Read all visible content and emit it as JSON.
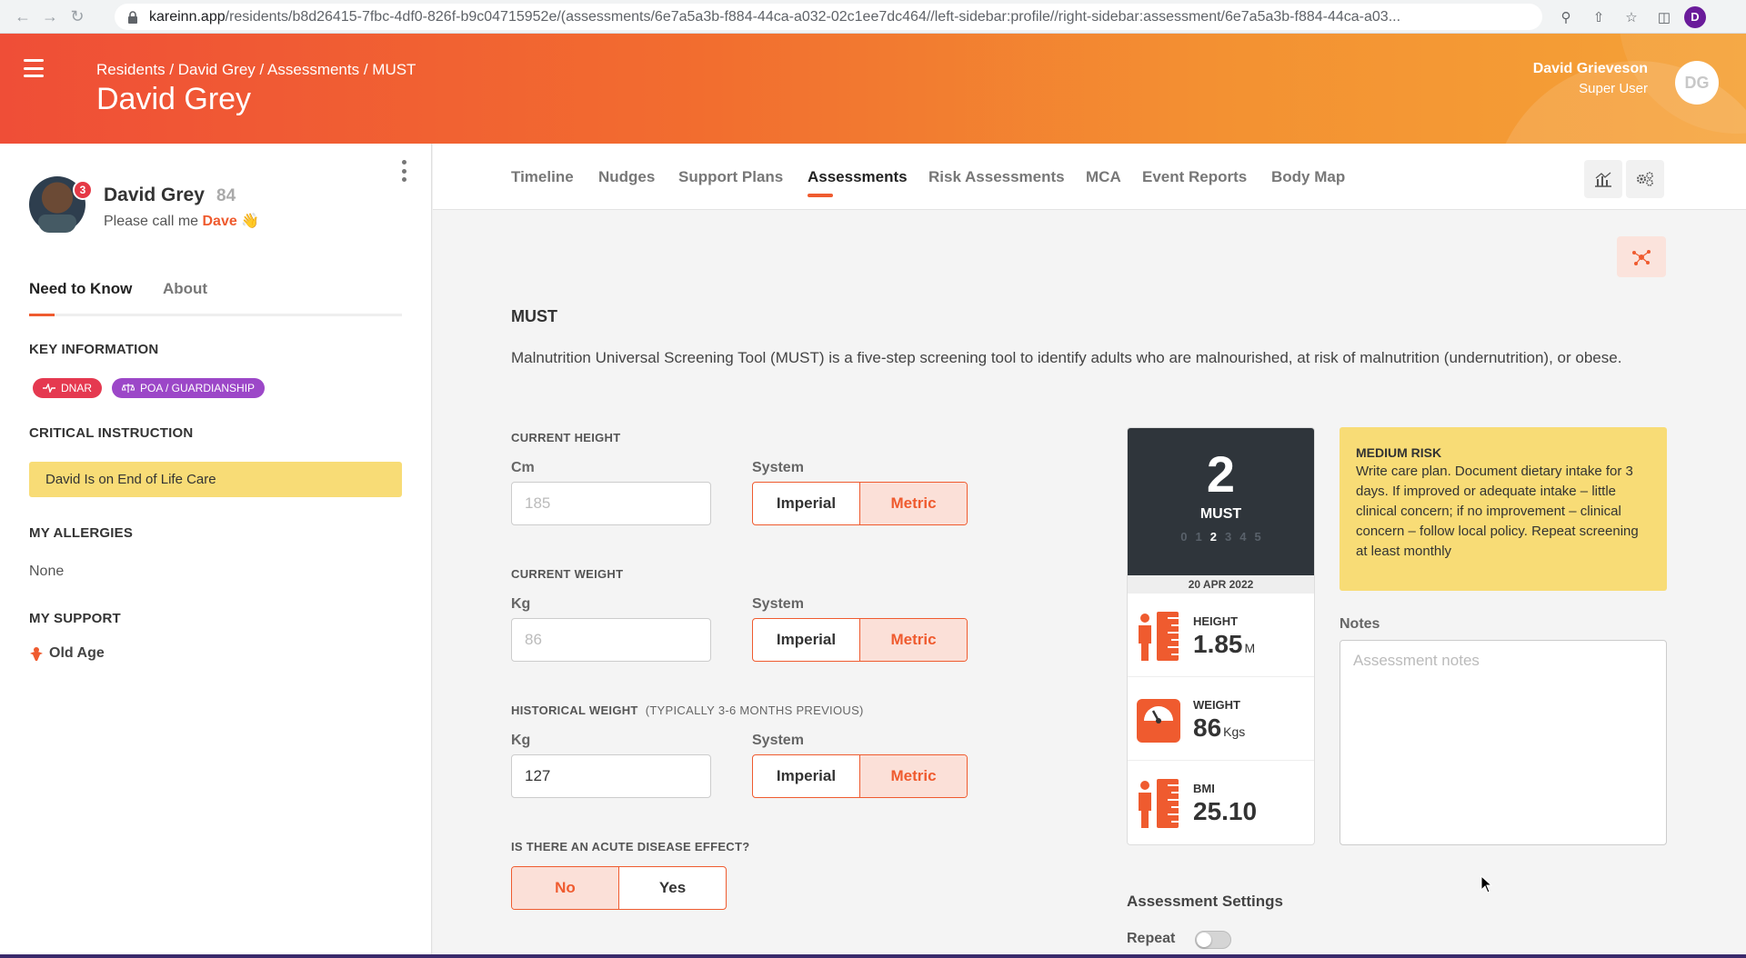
{
  "browser": {
    "url_host": "kareinn.app",
    "url_path": "/residents/b8d26415-7fbc-4df0-826f-b9c04715952e/(assessments/6e7a5a3b-f884-44ca-a032-02c1ee7dc464//left-sidebar:profile//right-sidebar:assessment/6e7a5a3b-f884-44ca-a03...",
    "profile_initial": "D"
  },
  "header": {
    "breadcrumb": "Residents / David Grey / Assessments / MUST",
    "title": "David Grey",
    "user_name": "David Grieveson",
    "user_role": "Super User",
    "user_initials": "DG"
  },
  "profile": {
    "name": "David Grey",
    "age": "84",
    "notification_count": "3",
    "nickname_prefix": "Please call me",
    "nickname": "Dave",
    "wave": "👋"
  },
  "sidebar": {
    "tabs": [
      "Need to Know",
      "About"
    ],
    "key_information_title": "KEY INFORMATION",
    "tags": [
      "DNAR",
      "POA / GUARDIANSHIP"
    ],
    "critical_title": "CRITICAL INSTRUCTION",
    "critical_text": "David Is on End of Life Care",
    "allergies_title": "MY ALLERGIES",
    "allergies_value": "None",
    "support_title": "MY SUPPORT",
    "support_item": "Old Age"
  },
  "nav": {
    "tabs": [
      "Timeline",
      "Nudges",
      "Support Plans",
      "Assessments",
      "Risk Assessments",
      "MCA",
      "Event Reports",
      "Body Map"
    ],
    "active_tab": "Assessments"
  },
  "form": {
    "title": "MUST",
    "description": "Malnutrition Universal Screening Tool (MUST) is a five-step screening tool to identify adults who are malnourished, at risk of malnutrition (undernutrition), or obese.",
    "system_label": "System",
    "system_options": [
      "Imperial",
      "Metric"
    ],
    "height": {
      "label": "CURRENT HEIGHT",
      "unit": "Cm",
      "placeholder": "185",
      "value": "",
      "system": "Metric"
    },
    "weight": {
      "label": "CURRENT WEIGHT",
      "unit": "Kg",
      "placeholder": "86",
      "value": "",
      "system": "Metric"
    },
    "historical": {
      "label": "HISTORICAL WEIGHT",
      "hint": "(TYPICALLY 3-6 MONTHS PREVIOUS)",
      "unit": "Kg",
      "placeholder": "",
      "value": "127",
      "system": "Metric"
    },
    "acute": {
      "label": "IS THERE AN ACUTE DISEASE EFFECT?",
      "options": [
        "No",
        "Yes"
      ],
      "selected": "No"
    }
  },
  "score": {
    "value": "2",
    "label": "MUST",
    "scale": [
      "0",
      "1",
      "2",
      "3",
      "4",
      "5"
    ],
    "current": 2,
    "date": "20 APR 2022",
    "metrics": [
      {
        "title": "HEIGHT",
        "value": "1.85",
        "unit": "M",
        "icon": "height-ruler-icon"
      },
      {
        "title": "WEIGHT",
        "value": "86",
        "unit": "Kgs",
        "icon": "scale-icon"
      },
      {
        "title": "BMI",
        "value": "25.10",
        "unit": "",
        "icon": "bmi-ruler-icon"
      }
    ]
  },
  "risk": {
    "title": "MEDIUM RISK",
    "text": "Write care plan. Document dietary intake for 3 days. If improved or adequate intake – little clinical concern; if no improvement – clinical concern – follow local policy. Repeat screening at least monthly"
  },
  "notes": {
    "label": "Notes",
    "placeholder": "Assessment notes"
  },
  "settings": {
    "title": "Assessment Settings",
    "repeat_label": "Repeat",
    "repeat_on": false
  },
  "colors": {
    "accent": "#ef5b2f",
    "highlight": "#f8dc76",
    "score_bg": "#2f353b",
    "dnar": "#e53950",
    "poa": "#9c47c8"
  }
}
